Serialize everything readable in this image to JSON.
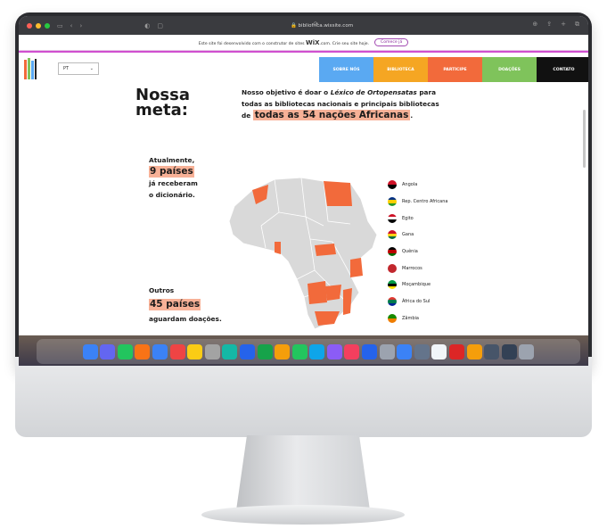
{
  "browser": {
    "url": "bibliofrica.wixsite.com",
    "traffic_lights": [
      "#ff5f57",
      "#febc2e",
      "#28c840"
    ]
  },
  "wix_banner": {
    "text_before": "Este site foi desenvolvido com o construtor de sites",
    "brand": "WiX",
    "text_after": ".com. Crie seu site hoje.",
    "cta": "Comece já"
  },
  "language": {
    "selected": "PT"
  },
  "nav": [
    {
      "label": "SOBRE NÓS",
      "color": "#5aa9f2"
    },
    {
      "label": "BIBLIOTECA",
      "color": "#f5a623"
    },
    {
      "label": "PARTICIPE",
      "color": "#f26a3b"
    },
    {
      "label": "DOAÇÕES",
      "color": "#7fc35b"
    },
    {
      "label": "CONTATO",
      "color": "#111111"
    }
  ],
  "hero": {
    "title_line1": "Nossa",
    "title_line2": "meta:",
    "goal_line1_a": "Nosso objetivo é doar o ",
    "goal_line1_italic": "Léxico de Ortopensatas",
    "goal_line1_b": " para",
    "goal_line2": "todas as bibliotecas nacionais e principais bibliotecas",
    "goal_line3_prefix": "de ",
    "goal_line3_highlight": "todas as 54 nações Africanas",
    "goal_line3_suffix": "."
  },
  "received": {
    "line1": "Atualmente,",
    "highlight": "9 países",
    "line3": "já receberam",
    "line4": "o dicionário."
  },
  "waiting": {
    "line1": "Outros",
    "highlight": "45 países",
    "line3": "aguardam doações."
  },
  "accent_color": "#f26a3b",
  "legend": [
    {
      "name": "Angola",
      "flag": [
        "#ce1126",
        "#000000"
      ]
    },
    {
      "name": "Rep. Centro Africana",
      "flag": [
        "#003082",
        "#ffce00",
        "#289728"
      ]
    },
    {
      "name": "Egito",
      "flag": [
        "#ce1126",
        "#ffffff",
        "#000000"
      ]
    },
    {
      "name": "Gana",
      "flag": [
        "#ce1126",
        "#fcd116",
        "#006b3f"
      ]
    },
    {
      "name": "Quênia",
      "flag": [
        "#000000",
        "#bb0000",
        "#006600"
      ]
    },
    {
      "name": "Marrocos",
      "flag": [
        "#c1272d",
        "#c1272d"
      ]
    },
    {
      "name": "Moçambique",
      "flag": [
        "#009a44",
        "#000000",
        "#fce100"
      ]
    },
    {
      "name": "África do Sul",
      "flag": [
        "#de3831",
        "#007a4d",
        "#002395"
      ]
    },
    {
      "name": "Zâmbia",
      "flag": [
        "#198a00",
        "#ef7d00"
      ]
    }
  ],
  "dock_colors": [
    "#3b82f6",
    "#6366f1",
    "#22c55e",
    "#f97316",
    "#3b82f6",
    "#ef4444",
    "#facc15",
    "#a3a3a3",
    "#14b8a6",
    "#2563eb",
    "#16a34a",
    "#f59e0b",
    "#22c55e",
    "#0ea5e9",
    "#8b5cf6",
    "#f43f5e",
    "#2563eb",
    "#9ca3af",
    "#3b82f6",
    "#64748b",
    "#f1f5f9",
    "#dc2626",
    "#f59e0b",
    "#475569",
    "#334155",
    "#9ca3af"
  ]
}
